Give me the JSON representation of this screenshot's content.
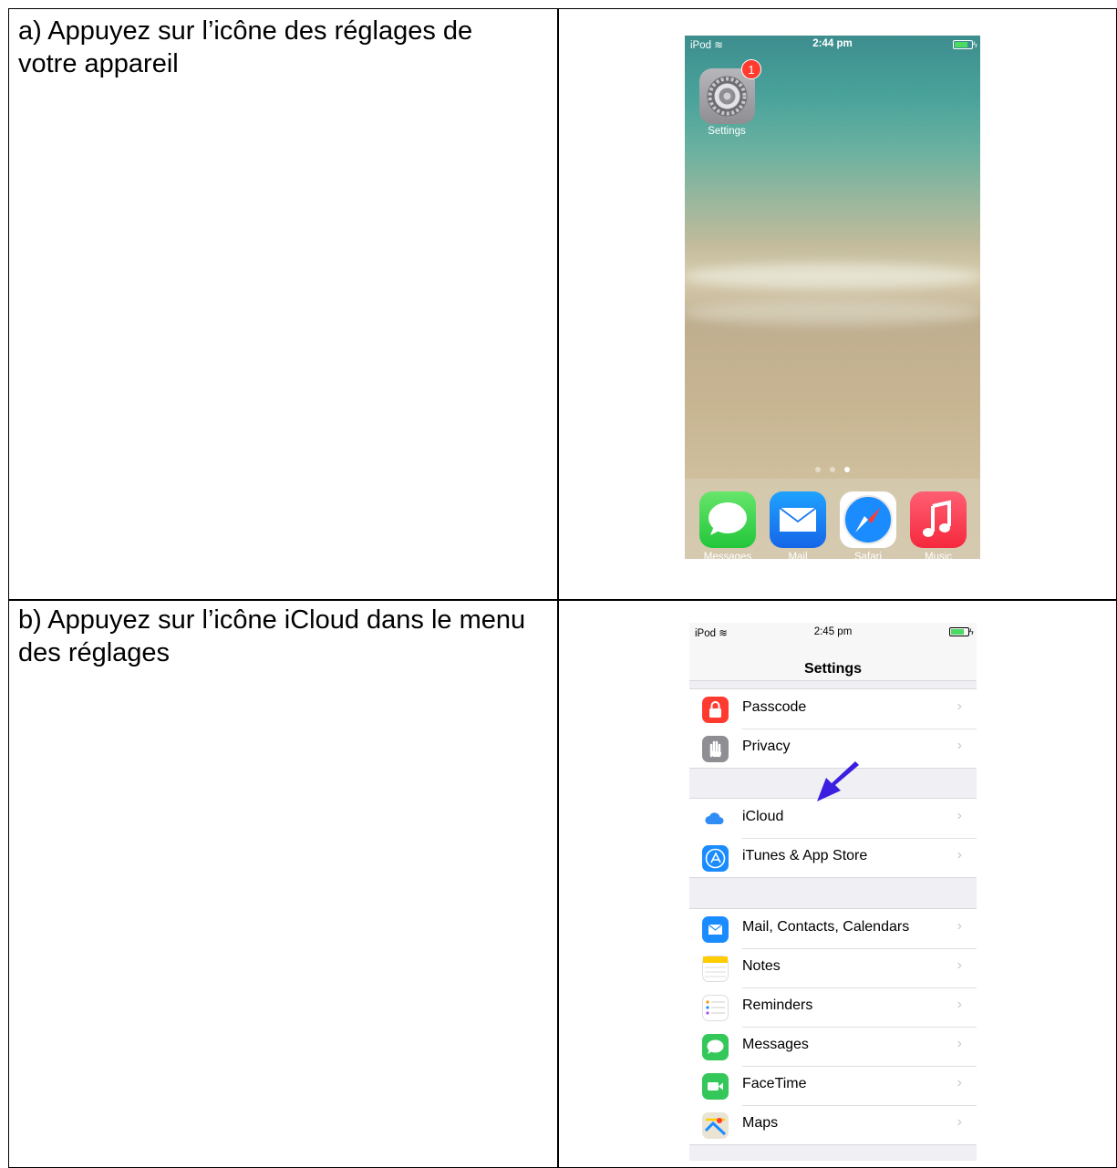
{
  "steps": [
    {
      "text": "a) Appuyez sur l’icône des réglages de votre appareil"
    },
    {
      "text": "b) Appuyez sur l’icône iCloud dans le menu des réglages"
    }
  ],
  "home_screen": {
    "carrier": "iPod",
    "time": "2:44 pm",
    "settings_app": {
      "label": "Settings",
      "badge": "1"
    },
    "page_dots": 3,
    "active_page": 3,
    "dock": [
      {
        "label": "Messages",
        "icon": "messages-icon"
      },
      {
        "label": "Mail",
        "icon": "mail-icon"
      },
      {
        "label": "Safari",
        "icon": "safari-icon"
      },
      {
        "label": "Music",
        "icon": "music-icon"
      }
    ]
  },
  "settings_screen": {
    "carrier": "iPod",
    "time": "2:45 pm",
    "title": "Settings",
    "group1": [
      {
        "label": "Passcode",
        "icon": "lock-icon"
      },
      {
        "label": "Privacy",
        "icon": "hand-icon"
      }
    ],
    "group2": [
      {
        "label": "iCloud",
        "icon": "cloud-icon"
      },
      {
        "label": "iTunes & App Store",
        "icon": "app-store-icon"
      }
    ],
    "group3": [
      {
        "label": "Mail, Contacts, Calendars",
        "icon": "mail-icon"
      },
      {
        "label": "Notes",
        "icon": "notes-icon"
      },
      {
        "label": "Reminders",
        "icon": "reminders-icon"
      },
      {
        "label": "Messages",
        "icon": "messages-icon"
      },
      {
        "label": "FaceTime",
        "icon": "facetime-icon"
      },
      {
        "label": "Maps",
        "icon": "maps-icon"
      }
    ],
    "chevron": "›",
    "pointer_color": "#3a1fe0"
  }
}
